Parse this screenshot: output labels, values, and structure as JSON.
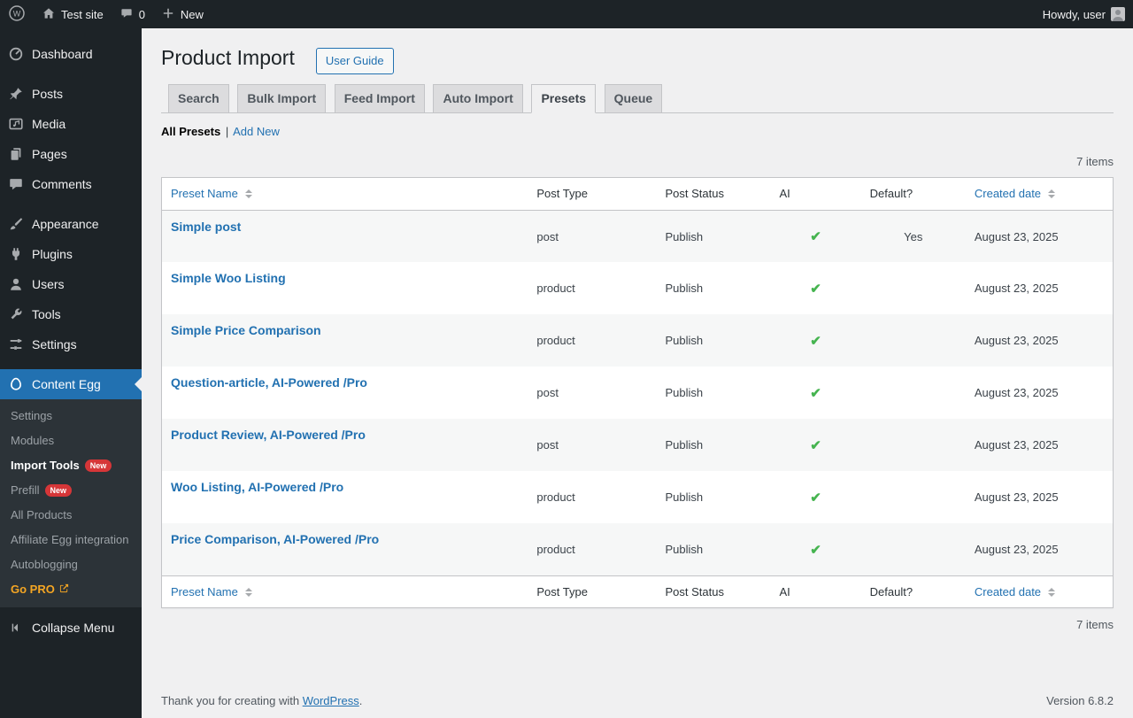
{
  "colors": {
    "accent_blue": "#2271b1",
    "success_green": "#46b450",
    "badge_red": "#d63638",
    "go_pro_orange": "#f5a623",
    "admin_dark": "#1d2327",
    "page_background": "#f0f0f1"
  },
  "icons": {
    "admin_bar": [
      "wordpress-logo-icon",
      "home-icon",
      "comments-bubble-icon",
      "plus-icon",
      "avatar"
    ],
    "sidebar": [
      "dashboard-icon",
      "posts-icon",
      "media-icon",
      "pages-icon",
      "comments-icon",
      "appearance-icon",
      "plugins-icon",
      "users-icon",
      "tools-icon",
      "settings-icon",
      "content-egg-icon",
      "collapse-icon"
    ],
    "other": [
      "external-link-icon",
      "sort-indicator-icon"
    ]
  },
  "admin_bar": {
    "site_name": "Test site",
    "comments_count": "0",
    "new_menu_label": "New",
    "howdy_text": "Howdy, user"
  },
  "sidebar": {
    "items": [
      {
        "label": "Dashboard"
      },
      {
        "label": "Posts"
      },
      {
        "label": "Media"
      },
      {
        "label": "Pages"
      },
      {
        "label": "Comments"
      },
      {
        "label": "Appearance"
      },
      {
        "label": "Plugins"
      },
      {
        "label": "Users"
      },
      {
        "label": "Tools"
      },
      {
        "label": "Settings"
      },
      {
        "label": "Content Egg"
      }
    ],
    "submenu": [
      {
        "label": "Settings"
      },
      {
        "label": "Modules"
      },
      {
        "label": "Import Tools",
        "badge": "New"
      },
      {
        "label": "Prefill",
        "badge": "New"
      },
      {
        "label": "All Products"
      },
      {
        "label": "Affiliate Egg integration"
      },
      {
        "label": "Autoblogging"
      },
      {
        "label": "Go PRO"
      }
    ],
    "collapse_label": "Collapse Menu"
  },
  "page": {
    "title": "Product Import",
    "user_guide_button": "User Guide",
    "tabs": [
      {
        "label": "Search"
      },
      {
        "label": "Bulk Import"
      },
      {
        "label": "Feed Import"
      },
      {
        "label": "Auto Import"
      },
      {
        "label": "Presets"
      },
      {
        "label": "Queue"
      }
    ],
    "active_tab": "Presets",
    "filter_all": "All Presets",
    "filter_separator": "|",
    "filter_add_new": "Add New",
    "items_count": "7 items"
  },
  "table": {
    "headers": {
      "name": "Preset Name",
      "post_type": "Post Type",
      "post_status": "Post Status",
      "ai": "AI",
      "default": "Default?",
      "created": "Created date"
    },
    "rows": [
      {
        "name": "Simple post",
        "post_type": "post",
        "post_status": "Publish",
        "ai": "✔",
        "default": "Yes",
        "created": "August 23, 2025"
      },
      {
        "name": "Simple Woo Listing",
        "post_type": "product",
        "post_status": "Publish",
        "ai": "✔",
        "default": "",
        "created": "August 23, 2025"
      },
      {
        "name": "Simple Price Comparison",
        "post_type": "product",
        "post_status": "Publish",
        "ai": "✔",
        "default": "",
        "created": "August 23, 2025"
      },
      {
        "name": "Question-article, AI-Powered /Pro",
        "post_type": "post",
        "post_status": "Publish",
        "ai": "✔",
        "default": "",
        "created": "August 23, 2025"
      },
      {
        "name": "Product Review, AI-Powered /Pro",
        "post_type": "post",
        "post_status": "Publish",
        "ai": "✔",
        "default": "",
        "created": "August 23, 2025"
      },
      {
        "name": "Woo Listing, AI-Powered /Pro",
        "post_type": "product",
        "post_status": "Publish",
        "ai": "✔",
        "default": "",
        "created": "August 23, 2025"
      },
      {
        "name": "Price Comparison, AI-Powered /Pro",
        "post_type": "product",
        "post_status": "Publish",
        "ai": "✔",
        "default": "",
        "created": "August 23, 2025"
      }
    ]
  },
  "footer": {
    "thank_you_prefix": "Thank you for creating with",
    "wordpress_link": "WordPress",
    "suffix": ".",
    "version": "Version 6.8.2"
  }
}
